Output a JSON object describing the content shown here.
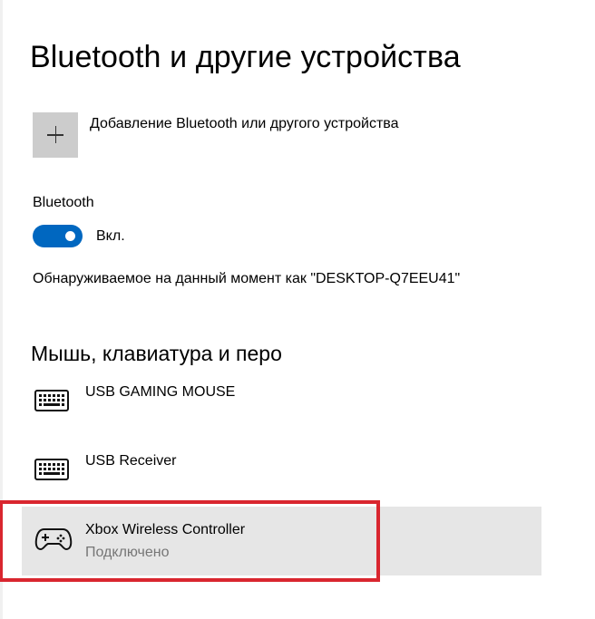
{
  "page": {
    "title": "Bluetooth и другие устройства"
  },
  "add_device": {
    "label": "Добавление Bluetooth или другого устройства",
    "icon": "plus-icon"
  },
  "bluetooth": {
    "label": "Bluetooth",
    "toggle_state": "Вкл.",
    "toggle_on": true,
    "accent_color": "#0067c0",
    "discoverable_text": "Обнаруживаемое на данный момент как \"DESKTOP-Q7EEU41\""
  },
  "section": {
    "title": "Мышь, клавиатура и перо"
  },
  "devices": [
    {
      "name": "USB GAMING MOUSE",
      "status": "",
      "icon": "keyboard-icon",
      "selected": false
    },
    {
      "name": "USB Receiver",
      "status": "",
      "icon": "keyboard-icon",
      "selected": false
    },
    {
      "name": "Xbox Wireless Controller",
      "status": "Подключено",
      "icon": "gamepad-icon",
      "selected": true
    }
  ],
  "colors": {
    "selected_row_bg": "#e6e6e6",
    "highlight_border": "#d9262f",
    "status_text": "#767676"
  }
}
